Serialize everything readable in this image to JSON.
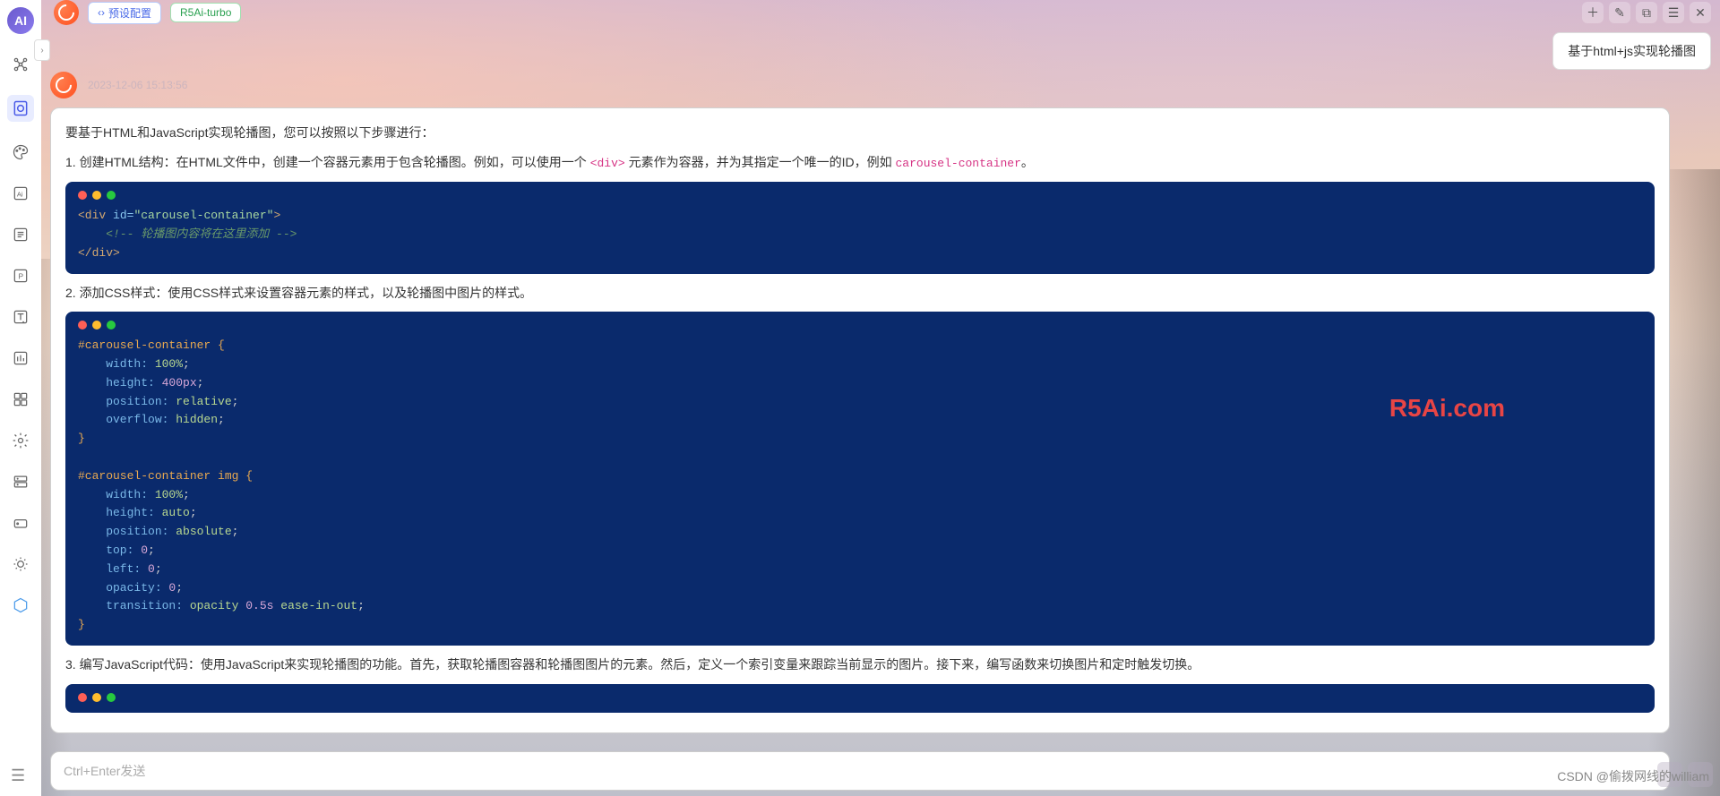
{
  "header": {
    "preset_label": "预设配置",
    "model_label": "R5Ai-turbo"
  },
  "title_box": "基于html+js实现轮播图",
  "top_right_icons": [
    "＋",
    "✎",
    "⧉",
    "☰",
    "✕"
  ],
  "message": {
    "timestamp": "2023-12-06 15:13:56",
    "intro": "要基于HTML和JavaScript实现轮播图，您可以按照以下步骤进行：",
    "step1_prefix": "1. 创建HTML结构：在HTML文件中，创建一个容器元素用于包含轮播图。例如，可以使用一个 ",
    "step1_code1": "<div>",
    "step1_mid": " 元素作为容器，并为其指定一个唯一的ID，例如 ",
    "step1_code2": "carousel-container",
    "step1_suffix": "。",
    "code1": {
      "l1a": "<div",
      "l1b": " id=",
      "l1c": "\"carousel-container\"",
      "l1d": ">",
      "l2": "    <!-- 轮播图内容将在这里添加 -->",
      "l3a": "</div>"
    },
    "step2": "2. 添加CSS样式：使用CSS样式来设置容器元素的样式，以及轮播图中图片的样式。",
    "code2": {
      "l1": "#carousel-container {",
      "l2a": "    width:",
      "l2b": " 100%",
      "l2c": ";",
      "l3a": "    height:",
      "l3b": " 400px",
      "l3c": ";",
      "l4a": "    position:",
      "l4b": " relative",
      "l4c": ";",
      "l5a": "    overflow:",
      "l5b": " hidden",
      "l5c": ";",
      "l6": "}",
      "l7": "",
      "l8": "#carousel-container img {",
      "l9a": "    width:",
      "l9b": " 100%",
      "l9c": ";",
      "l10a": "    height:",
      "l10b": " auto",
      "l10c": ";",
      "l11a": "    position:",
      "l11b": " absolute",
      "l11c": ";",
      "l12a": "    top:",
      "l12b": " 0",
      "l12c": ";",
      "l13a": "    left:",
      "l13b": " 0",
      "l13c": ";",
      "l14a": "    opacity:",
      "l14b": " 0",
      "l14c": ";",
      "l15a": "    transition:",
      "l15b": " opacity",
      "l15c": " 0.5s",
      "l15d": " ease-in-out",
      "l15e": ";",
      "l16": "}"
    },
    "step3": "3. 编写JavaScript代码：使用JavaScript来实现轮播图的功能。首先，获取轮播图容器和轮播图图片的元素。然后，定义一个索引变量来跟踪当前显示的图片。接下来，编写函数来切换图片和定时触发切换。"
  },
  "input": {
    "placeholder": "Ctrl+Enter发送"
  },
  "watermark": "R5Ai.com",
  "csdn": "CSDN @偷拨网线的william",
  "sidebar_names": [
    "main-logo",
    "nodes",
    "page-active",
    "palette",
    "ai",
    "list",
    "pdf",
    "text",
    "chart",
    "apps",
    "gear",
    "server",
    "drive",
    "sun",
    "hex"
  ]
}
